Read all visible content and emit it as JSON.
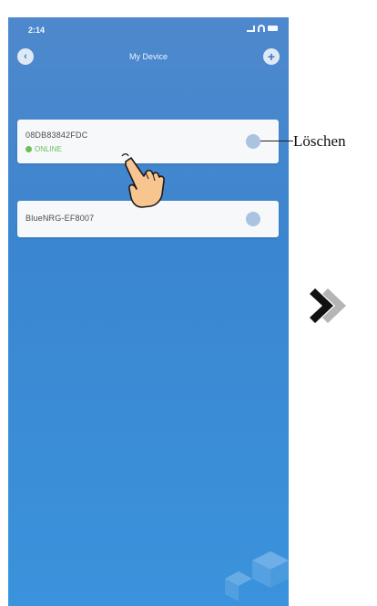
{
  "status_bar": {
    "time": "2:14"
  },
  "nav": {
    "title": "My Device",
    "back_icon": "back-icon",
    "add_icon": "plus-icon"
  },
  "devices": [
    {
      "name": "08DB83842FDC",
      "status": "ONLINE",
      "status_color": "#6bbf59"
    },
    {
      "name": "BlueNRG-EF8007"
    }
  ],
  "annotation": {
    "label": "Löschen"
  },
  "colors": {
    "background_top": "#4f88cc",
    "background_bottom": "#3a93dc",
    "card": "#f7f8fa",
    "online": "#6bbf59"
  }
}
